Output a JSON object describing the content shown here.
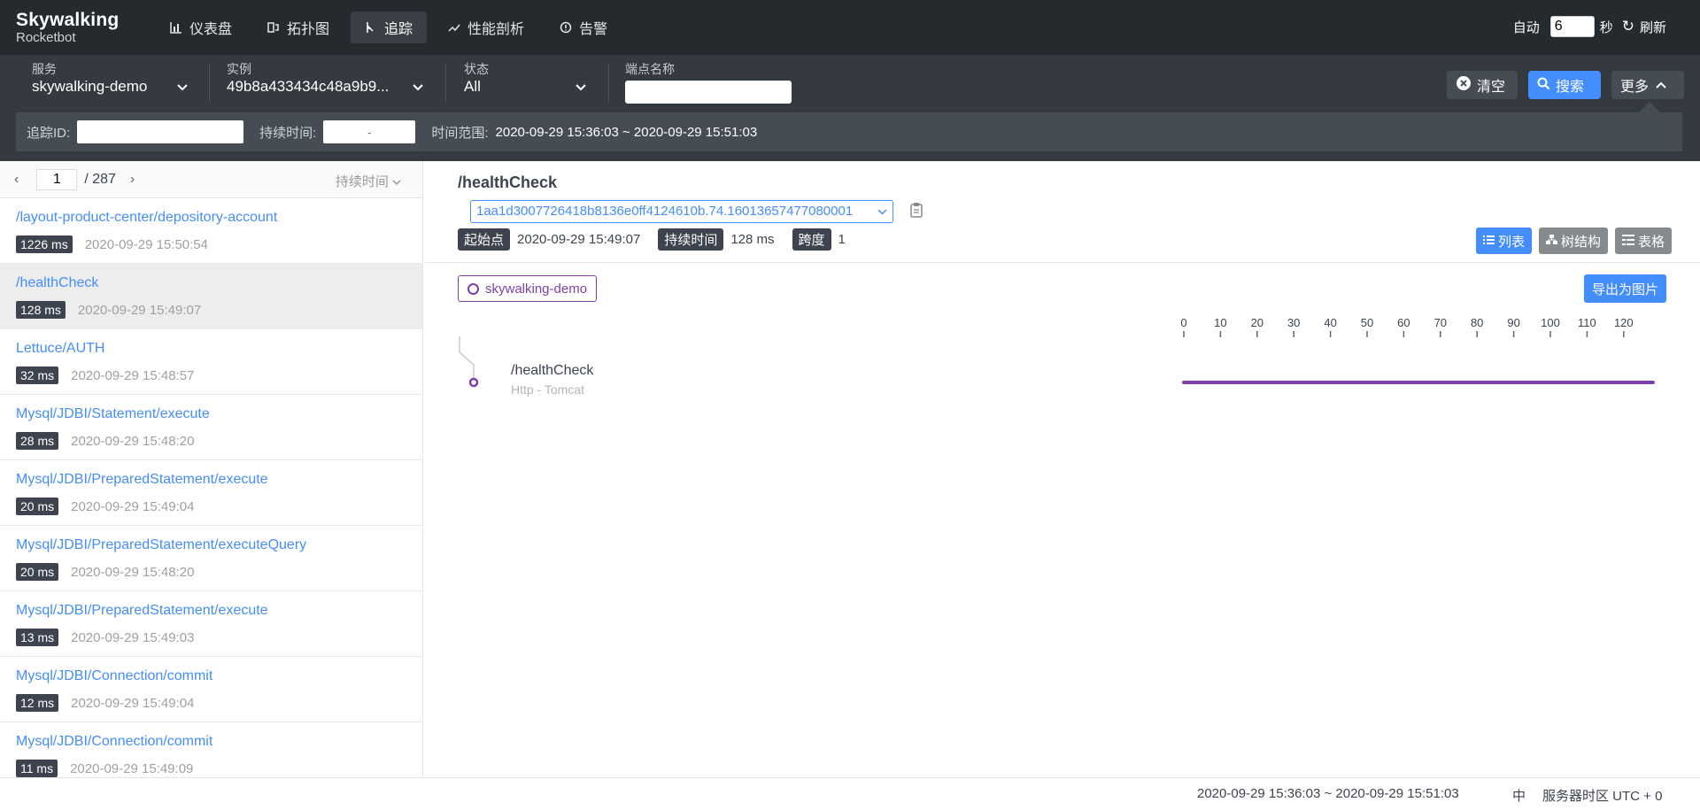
{
  "header": {
    "logo_title": "Skywalking",
    "logo_sub": "Rocketbot",
    "nav": [
      {
        "label": "仪表盘",
        "icon": "chart-icon"
      },
      {
        "label": "拓扑图",
        "icon": "topology-icon"
      },
      {
        "label": "追踪",
        "icon": "trace-icon"
      },
      {
        "label": "性能剖析",
        "icon": "profile-icon"
      },
      {
        "label": "告警",
        "icon": "alarm-icon"
      }
    ],
    "auto_label": "自动",
    "interval_value": "6",
    "seconds_label": "秒",
    "refresh_label": "刷新"
  },
  "filters": {
    "service_label": "服务",
    "service_value": "skywalking-demo",
    "instance_label": "实例",
    "instance_value": "49b8a433434c48a9b9...",
    "status_label": "状态",
    "status_value": "All",
    "endpoint_label": "端点名称",
    "endpoint_value": "",
    "clear_label": "清空",
    "search_label": "搜索",
    "more_label": "更多",
    "traceid_label": "追踪ID:",
    "traceid_value": "",
    "duration_label": "持续时间:",
    "duration_placeholder": "-",
    "timerange_label": "时间范围:",
    "timerange_value": "2020-09-29 15:36:03 ~ 2020-09-29 15:51:03"
  },
  "list": {
    "page": "1",
    "total": "/ 287",
    "sort_label": "持续时间",
    "items": [
      {
        "endpoint": "/layout-product-center/depository-account",
        "duration": "1226 ms",
        "time": "2020-09-29 15:50:54"
      },
      {
        "endpoint": "/healthCheck",
        "duration": "128 ms",
        "time": "2020-09-29 15:49:07"
      },
      {
        "endpoint": "Lettuce/AUTH",
        "duration": "32 ms",
        "time": "2020-09-29 15:48:57"
      },
      {
        "endpoint": "Mysql/JDBI/Statement/execute",
        "duration": "28 ms",
        "time": "2020-09-29 15:48:20"
      },
      {
        "endpoint": "Mysql/JDBI/PreparedStatement/execute",
        "duration": "20 ms",
        "time": "2020-09-29 15:49:04"
      },
      {
        "endpoint": "Mysql/JDBI/PreparedStatement/executeQuery",
        "duration": "20 ms",
        "time": "2020-09-29 15:48:20"
      },
      {
        "endpoint": "Mysql/JDBI/PreparedStatement/execute",
        "duration": "13 ms",
        "time": "2020-09-29 15:49:03"
      },
      {
        "endpoint": "Mysql/JDBI/Connection/commit",
        "duration": "12 ms",
        "time": "2020-09-29 15:49:04"
      },
      {
        "endpoint": "Mysql/JDBI/Connection/commit",
        "duration": "11 ms",
        "time": "2020-09-29 15:49:09"
      }
    ]
  },
  "detail": {
    "title": "/healthCheck",
    "trace_id": "1aa1d3007726418b8136e0ff4124610b.74.16013657477080001",
    "start_label": "起始点",
    "start_value": "2020-09-29 15:49:07",
    "duration_label": "持续时间",
    "duration_value": "128 ms",
    "span_label": "跨度",
    "span_value": "1",
    "view_list": "列表",
    "view_tree": "树结构",
    "view_table": "表格",
    "service_chip": "skywalking-demo",
    "export_label": "导出为图片",
    "axis_ticks": [
      "0",
      "10",
      "20",
      "30",
      "40",
      "50",
      "60",
      "70",
      "80",
      "90",
      "100",
      "110",
      "120"
    ],
    "span": {
      "name": "/healthCheck",
      "sub": "Http - Tomcat",
      "start_ms": 0,
      "duration_ms": 128,
      "color": "#7e3fa8"
    }
  },
  "footer": {
    "range": "2020-09-29 15:36:03 ~ 2020-09-29 15:51:03",
    "lang": "中",
    "tz": "服务器时区 UTC + 0"
  }
}
